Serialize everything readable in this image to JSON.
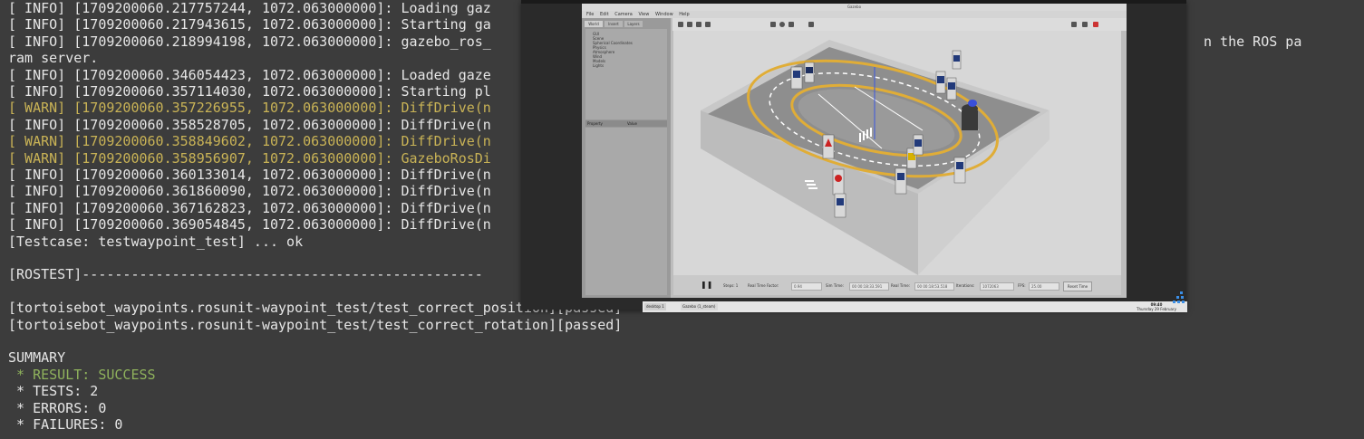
{
  "terminal": {
    "lines": [
      {
        "text": "[ INFO] [1709200060.217757244, 1072.063000000]: Loading gaz",
        "style": "info"
      },
      {
        "text": "[ INFO] [1709200060.217943615, 1072.063000000]: Starting ga",
        "style": "info"
      },
      {
        "text": "[ INFO] [1709200060.218994198, 1072.063000000]: gazebo_ros_",
        "style": "info"
      },
      {
        "text": "ram server.",
        "style": "info"
      },
      {
        "text": "[ INFO] [1709200060.346054423, 1072.063000000]: Loaded gaze",
        "style": "info"
      },
      {
        "text": "[ INFO] [1709200060.357114030, 1072.063000000]: Starting pl",
        "style": "info"
      },
      {
        "text": "[ WARN] [1709200060.357226955, 1072.063000000]: DiffDrive(n",
        "style": "warn"
      },
      {
        "text": "[ INFO] [1709200060.358528705, 1072.063000000]: DiffDrive(n",
        "style": "info"
      },
      {
        "text": "[ WARN] [1709200060.358849602, 1072.063000000]: DiffDrive(n",
        "style": "warn"
      },
      {
        "text": "[ WARN] [1709200060.358956907, 1072.063000000]: GazeboRosDi",
        "style": "warn"
      },
      {
        "text": "[ INFO] [1709200060.360133014, 1072.063000000]: DiffDrive(n",
        "style": "info"
      },
      {
        "text": "[ INFO] [1709200060.361860090, 1072.063000000]: DiffDrive(n",
        "style": "info"
      },
      {
        "text": "[ INFO] [1709200060.367162823, 1072.063000000]: DiffDrive(n",
        "style": "info"
      },
      {
        "text": "[ INFO] [1709200060.369054845, 1072.063000000]: DiffDrive(n",
        "style": "info"
      },
      {
        "text": "[Testcase: testwaypoint_test] ... ok",
        "style": "info"
      },
      {
        "text": "",
        "style": "info"
      },
      {
        "text": "[ROSTEST]-------------------------------------------------",
        "style": "info"
      },
      {
        "text": "",
        "style": "info"
      },
      {
        "text": "[tortoisebot_waypoints.rosunit-waypoint_test/test_correct_position][passed]",
        "style": "info"
      },
      {
        "text": "[tortoisebot_waypoints.rosunit-waypoint_test/test_correct_rotation][passed]",
        "style": "info"
      },
      {
        "text": "",
        "style": "info"
      },
      {
        "text": "SUMMARY",
        "style": "info"
      },
      {
        "text": " * RESULT: SUCCESS",
        "style": "success"
      },
      {
        "text": " * TESTS: 2",
        "style": "info"
      },
      {
        "text": " * ERRORS: 0",
        "style": "info"
      },
      {
        "text": " * FAILURES: 0",
        "style": "info"
      }
    ],
    "right_overflow_1": "n the ROS pa"
  },
  "gazebo": {
    "title": "Gazebo",
    "menu": [
      "File",
      "Edit",
      "Camera",
      "View",
      "Window",
      "Help"
    ],
    "left_tabs": [
      "World",
      "Insert",
      "Layers"
    ],
    "tree_items": [
      "GUI",
      "Scene",
      "Spherical Coordinates",
      "Physics",
      "Atmosphere",
      "Wind",
      "Models",
      "Lights"
    ],
    "prop_header": {
      "property": "Property",
      "value": "Value"
    },
    "bottom": {
      "steps_label": "Steps: 1",
      "rtf_label": "Real Time Factor:",
      "rtf_value": "0.94",
      "sim_label": "Sim Time:",
      "sim_value": "00 00:18:33.591",
      "real_label": "Real Time:",
      "real_value": "00 00:18:53.518",
      "iter_label": "Iterations:",
      "iter_value": "1072063",
      "fps_label": "FPS:",
      "fps_value": "25.00",
      "reset_label": "Reset Time"
    },
    "taskbar": {
      "desktop": "desktop 1",
      "app": "Gazebo (1_steam)",
      "time": "09:40",
      "date": "Thursday 29 February"
    },
    "colors": {
      "floor": "#8f8f8f",
      "track_line": "#e2b13a",
      "wall": "#c5c5c5",
      "robot_top": "#3a4fd8"
    }
  }
}
